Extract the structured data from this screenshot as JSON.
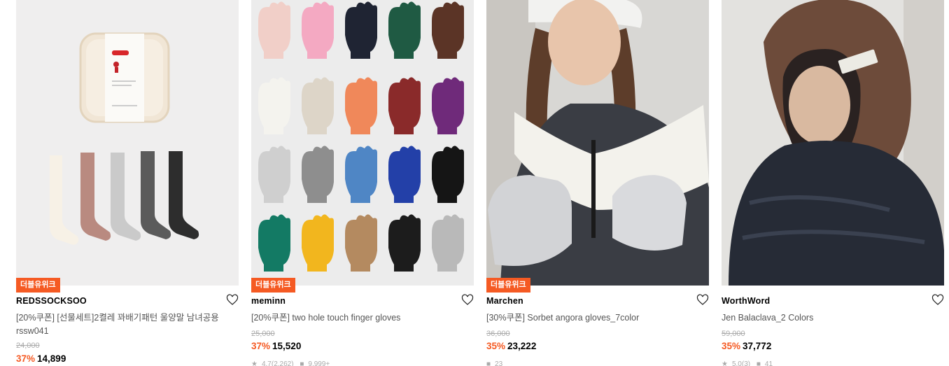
{
  "colors": {
    "accent": "#f55a23",
    "badge_text": "#ffffff",
    "muted": "#aaaaaa"
  },
  "products": [
    {
      "badge": "더블유위크",
      "brand": "REDSSOCKSOO",
      "title": "[20%쿠폰] [선물세트]2켤레 꽈배기패턴 울양말 남녀공용 rssw041",
      "original_price": "24,000",
      "discount": "37%",
      "price": "14,899",
      "rating": "",
      "reviews": "",
      "icon": "heart-outline-icon"
    },
    {
      "badge": "더블유위크",
      "brand": "meminn",
      "title": "[20%쿠폰] two hole touch finger gloves",
      "original_price": "25,000",
      "discount": "37%",
      "price": "15,520",
      "rating": "4.7(2,262)",
      "reviews": "9,999+",
      "icon": "heart-outline-icon"
    },
    {
      "badge": "더블유위크",
      "brand": "Marchen",
      "title": "[30%쿠폰] Sorbet angora gloves_7color",
      "original_price": "36,000",
      "discount": "35%",
      "price": "23,222",
      "rating": "",
      "reviews": "23",
      "icon": "heart-outline-icon"
    },
    {
      "badge": "",
      "brand": "WorthWord",
      "title": "Jen Balaclava_2 Colors",
      "original_price": "59,000",
      "discount": "35%",
      "price": "37,772",
      "rating": "5.0(3)",
      "reviews": "41",
      "icon": "heart-outline-icon"
    }
  ]
}
